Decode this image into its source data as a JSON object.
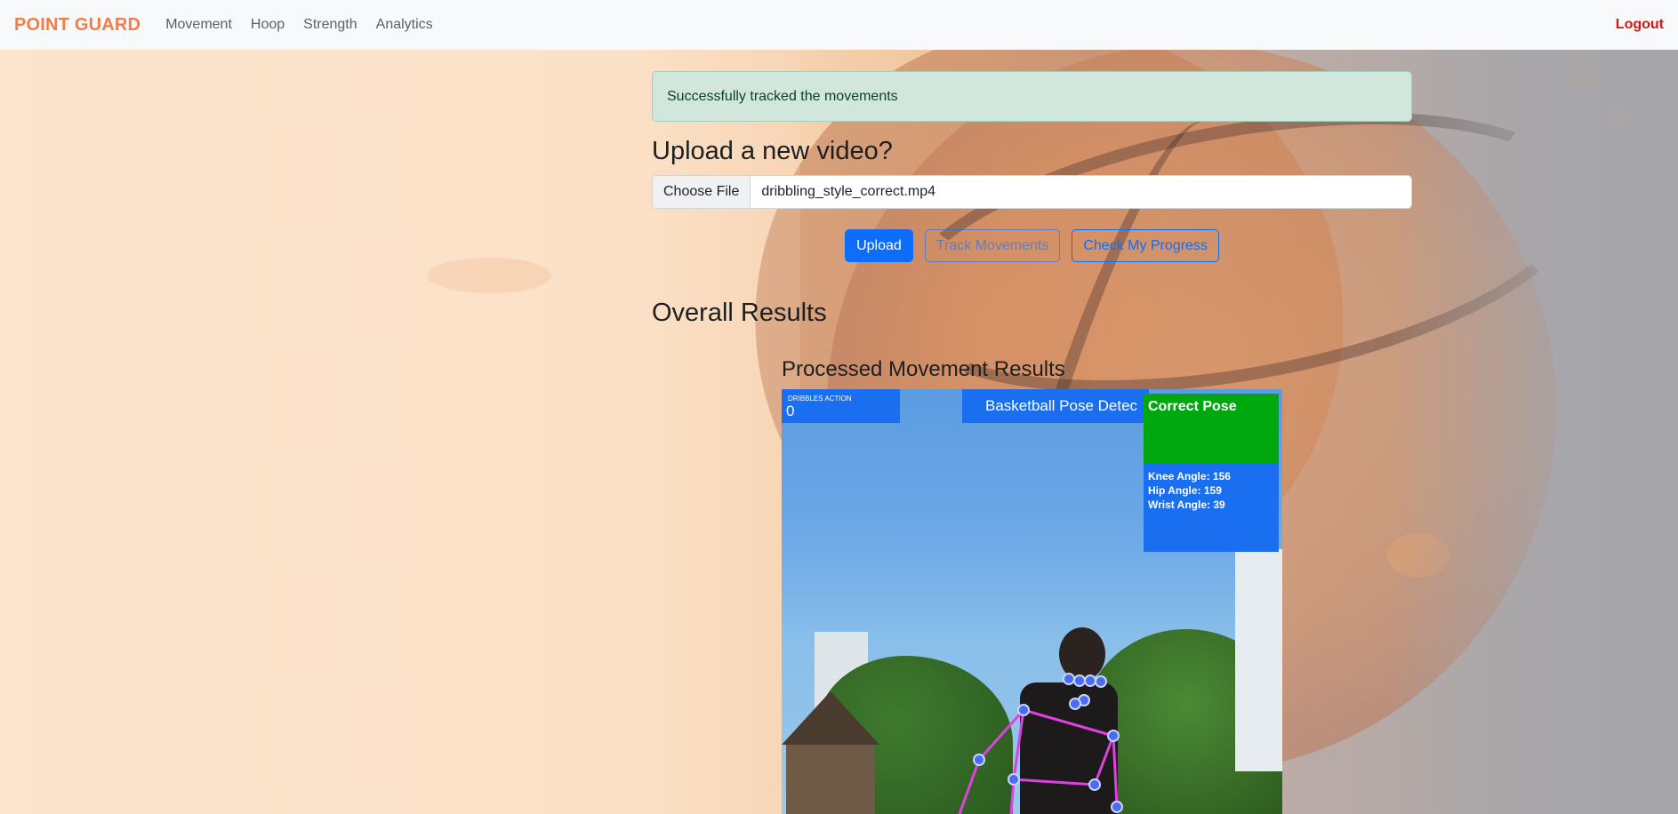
{
  "navbar": {
    "brand": "POINT GUARD",
    "links": [
      "Movement",
      "Hoop",
      "Strength",
      "Analytics"
    ],
    "logout": "Logout",
    "brand_color": "#f47c48",
    "logout_color": "#dc1414"
  },
  "alert": {
    "message": "Successfully tracked the movements"
  },
  "upload": {
    "title": "Upload a new video?",
    "choose_file_label": "Choose File",
    "file_name": "dribbling_style_correct.mp4"
  },
  "buttons": {
    "upload": "Upload",
    "track": "Track Movements",
    "progress": "Check My Progress"
  },
  "results": {
    "overall_title": "Overall Results",
    "processed_title": "Processed Movement Results",
    "video": {
      "action_label": "DRIBBLES ACTION",
      "action_count": "0",
      "banner": "Basketball Pose Detec",
      "pose_status": "Correct Pose",
      "angles": [
        "Knee Angle: 156",
        "Hip Angle: 159",
        "Wrist Angle: 39"
      ]
    }
  },
  "colors": {
    "primary": "#0d6efd",
    "alert_bg": "#d1e7dd",
    "pose_correct": "#00a80f",
    "overlay_blue": "#1a6ff0",
    "skeleton": "#e040e0"
  }
}
